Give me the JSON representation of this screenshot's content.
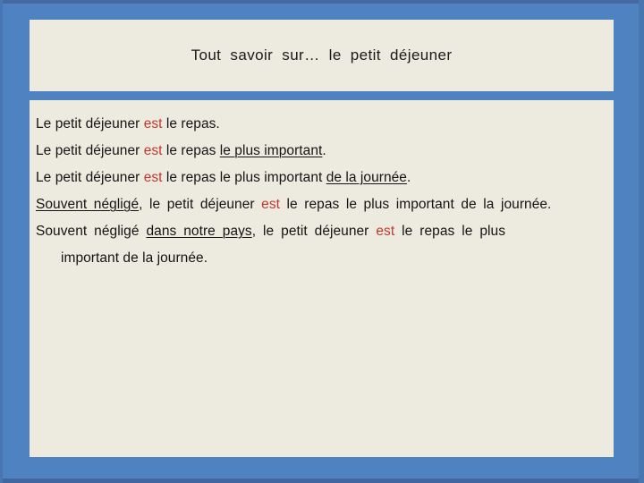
{
  "slide": {
    "title": "Tout  savoir  sur…  le  petit  déjeuner",
    "colors": {
      "frame_blue": "#4e82c0",
      "frame_blue_dark": "#44699f",
      "panel_cream": "#edeae0",
      "text_black": "#141414",
      "accent_red": "#c0392b"
    },
    "body_lines": [
      {
        "id": "line-1",
        "segments": [
          {
            "text": "Le petit déjeuner ",
            "style": "plain"
          },
          {
            "text": "est",
            "style": "red"
          },
          {
            "text": " le repas.",
            "style": "plain"
          }
        ]
      },
      {
        "id": "line-2",
        "segments": [
          {
            "text": "Le petit déjeuner ",
            "style": "plain"
          },
          {
            "text": "est",
            "style": "red"
          },
          {
            "text": " le repas ",
            "style": "plain"
          },
          {
            "text": "le plus important",
            "style": "underline"
          },
          {
            "text": ".",
            "style": "plain"
          }
        ]
      },
      {
        "id": "line-3",
        "segments": [
          {
            "text": "Le petit déjeuner ",
            "style": "plain"
          },
          {
            "text": "est",
            "style": "red"
          },
          {
            "text": " le repas le plus important ",
            "style": "plain"
          },
          {
            "text": "de  la journée",
            "style": "underline"
          },
          {
            "text": ".",
            "style": "plain"
          }
        ]
      },
      {
        "id": "line-4",
        "segments": [
          {
            "text": "Souvent négligé",
            "style": "underline"
          },
          {
            "text": ", le petit déjeuner ",
            "style": "plain"
          },
          {
            "text": "est",
            "style": "red"
          },
          {
            "text": " le repas le plus important de la journée.",
            "style": "plain"
          }
        ]
      },
      {
        "id": "line-5",
        "segments": [
          {
            "text": "Souvent  négligé ",
            "style": "plain"
          },
          {
            "text": "dans  notre  pays",
            "style": "underline"
          },
          {
            "text": ",  le  petit  déjeuner ",
            "style": "plain"
          },
          {
            "text": "est",
            "style": "red"
          },
          {
            "text": "  le  repas  le  plus",
            "style": "plain"
          }
        ]
      },
      {
        "id": "line-6",
        "indent": true,
        "segments": [
          {
            "text": "important de la journée.",
            "style": "plain"
          }
        ]
      }
    ]
  }
}
